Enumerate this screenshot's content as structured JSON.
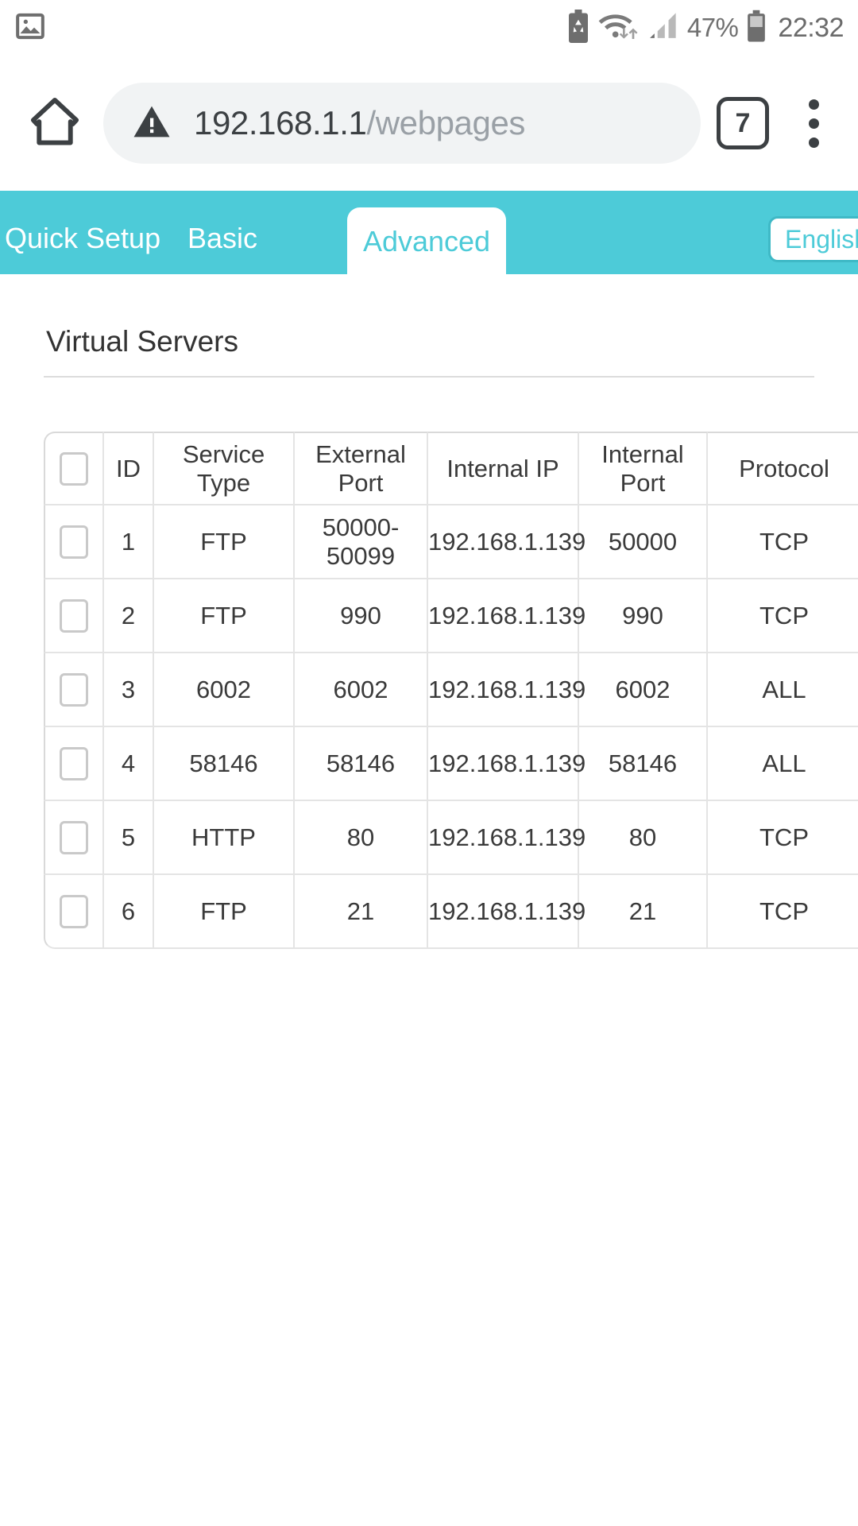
{
  "statusbar": {
    "icons": [
      "image-icon",
      "battery-saver-icon",
      "wifi-icon",
      "cellular-signal-icon",
      "battery-icon"
    ],
    "battery_percent": "47%",
    "clock": "22:32"
  },
  "browser": {
    "home_label": "home-icon",
    "security_icon": "warning-triangle-icon",
    "url_host": "192.168.1.1",
    "url_path": "/webpages",
    "tab_count": "7",
    "menu_label": "more-options-icon"
  },
  "router": {
    "accent_color": "#4dcbd8",
    "tabs": [
      {
        "label": "Quick Setup",
        "active": false
      },
      {
        "label": "Basic",
        "active": false
      },
      {
        "label": "Advanced",
        "active": true
      }
    ],
    "language": "English"
  },
  "page": {
    "title": "Virtual Servers"
  },
  "table": {
    "columns": [
      "",
      "ID",
      "Service Type",
      "External Port",
      "Internal IP",
      "Internal Port",
      "Protocol"
    ],
    "rows": [
      {
        "id": "1",
        "service_type": "FTP",
        "external_port": "50000-50099",
        "internal_ip": "192.168.1.139",
        "internal_port": "50000",
        "protocol": "TCP"
      },
      {
        "id": "2",
        "service_type": "FTP",
        "external_port": "990",
        "internal_ip": "192.168.1.139",
        "internal_port": "990",
        "protocol": "TCP"
      },
      {
        "id": "3",
        "service_type": "6002",
        "external_port": "6002",
        "internal_ip": "192.168.1.139",
        "internal_port": "6002",
        "protocol": "ALL"
      },
      {
        "id": "4",
        "service_type": "58146",
        "external_port": "58146",
        "internal_ip": "192.168.1.139",
        "internal_port": "58146",
        "protocol": "ALL"
      },
      {
        "id": "5",
        "service_type": "HTTP",
        "external_port": "80",
        "internal_ip": "192.168.1.139",
        "internal_port": "80",
        "protocol": "TCP"
      },
      {
        "id": "6",
        "service_type": "FTP",
        "external_port": "21",
        "internal_ip": "192.168.1.139",
        "internal_port": "21",
        "protocol": "TCP"
      }
    ]
  }
}
